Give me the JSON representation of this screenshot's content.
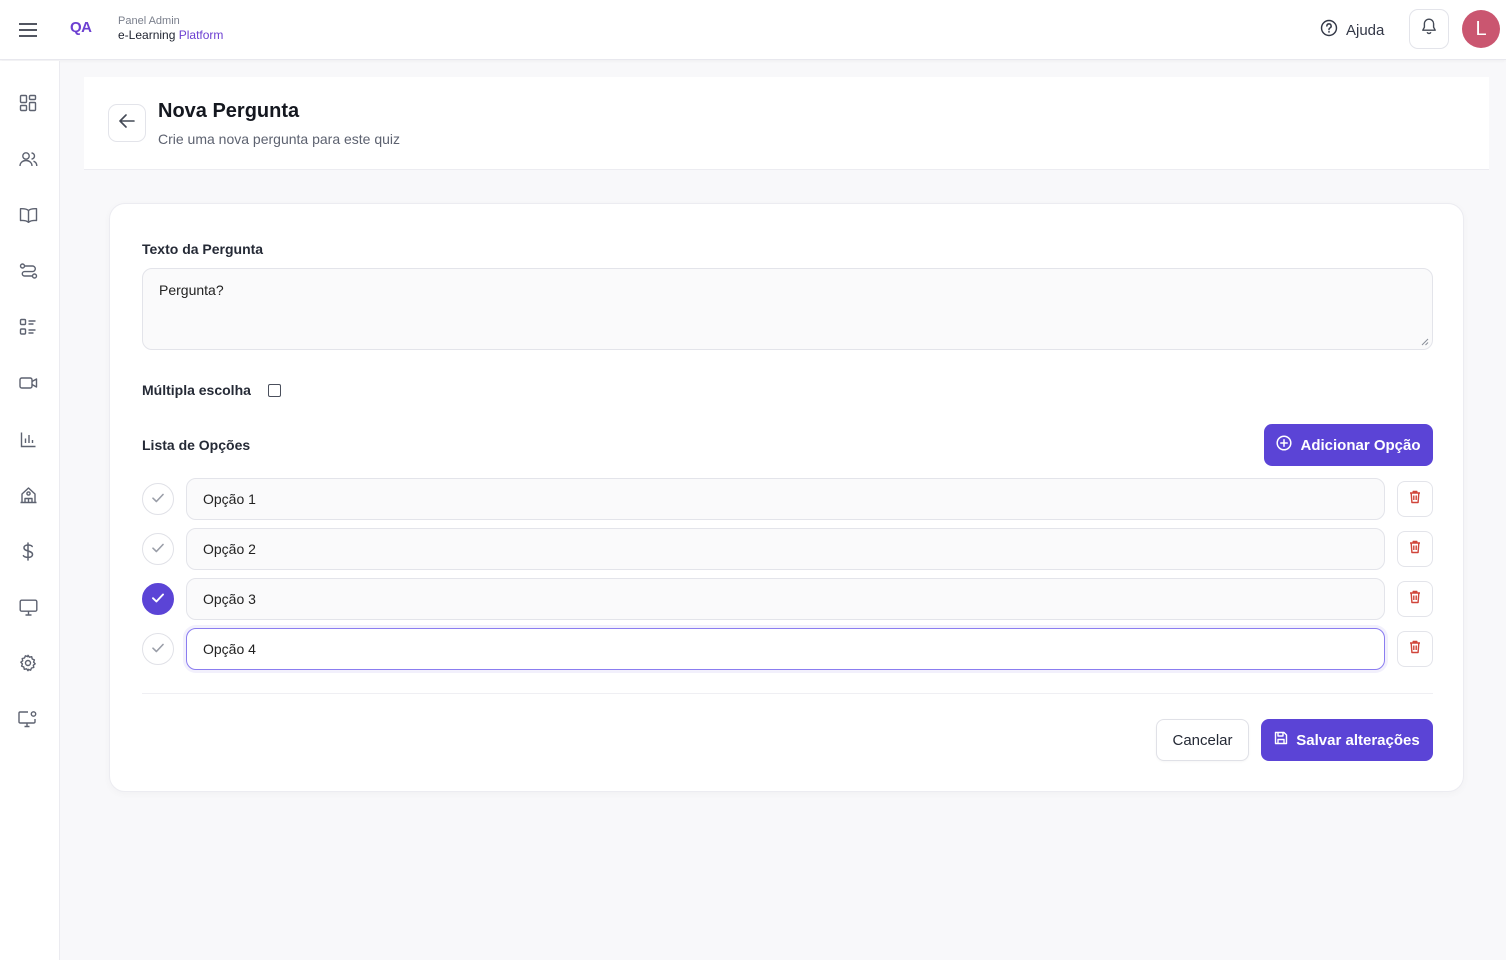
{
  "brand": {
    "logo": "QA",
    "subtitle": "Panel Admin",
    "name_prefix": "e-Learning",
    "name_accent": "Platform"
  },
  "header": {
    "help_label": "Ajuda",
    "avatar_initial": "L"
  },
  "sidebar": {
    "items": [
      {
        "icon": "dashboard-icon"
      },
      {
        "icon": "users-icon"
      },
      {
        "icon": "book-icon"
      },
      {
        "icon": "route-icon"
      },
      {
        "icon": "list-icon"
      },
      {
        "icon": "video-icon"
      },
      {
        "icon": "bar-chart-icon"
      },
      {
        "icon": "building-icon"
      },
      {
        "icon": "dollar-icon"
      },
      {
        "icon": "monitor-icon"
      },
      {
        "icon": "gear-icon"
      },
      {
        "icon": "monitor-settings-icon"
      }
    ]
  },
  "page": {
    "title": "Nova Pergunta",
    "subtitle": "Crie uma nova pergunta para este quiz"
  },
  "form": {
    "question_label": "Texto da Pergunta",
    "question_value": "Pergunta?",
    "multiple_choice_label": "Múltipla escolha",
    "multiple_choice_checked": false,
    "options_label": "Lista de Opções",
    "add_option_label": "Adicionar Opção",
    "options": [
      {
        "value": "Opção 1",
        "correct": false
      },
      {
        "value": "Opção 2",
        "correct": false
      },
      {
        "value": "Opção 3",
        "correct": true
      },
      {
        "value": "Opção 4",
        "correct": false
      }
    ],
    "cancel_label": "Cancelar",
    "save_label": "Salvar alterações"
  },
  "colors": {
    "accent": "#5b44d6",
    "brand": "#6c3fd1",
    "danger": "#d0453a",
    "avatar": "#ca5670"
  }
}
